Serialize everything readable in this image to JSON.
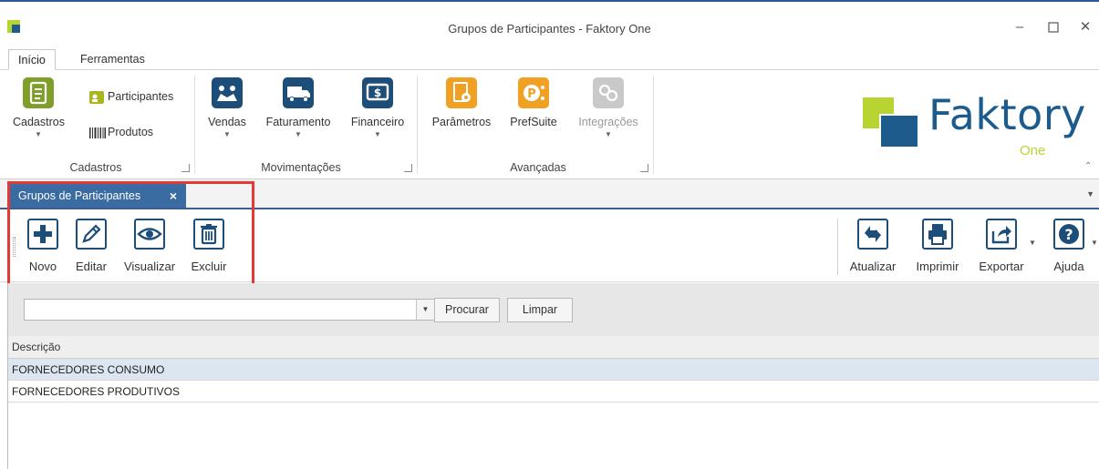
{
  "window": {
    "title": "Grupos de Participantes - Faktory One",
    "controls": [
      "minimize-icon",
      "maximize-icon",
      "close-icon"
    ]
  },
  "ribbon": {
    "tabs": [
      {
        "label": "Início",
        "active": true
      },
      {
        "label": "Ferramentas",
        "active": false
      }
    ],
    "groups": [
      {
        "label": "Cadastros",
        "large_buttons": [
          {
            "label": "Cadastros",
            "icon": "document-icon",
            "dropdown": true
          }
        ],
        "small_buttons": [
          {
            "label": "Participantes",
            "icon": "contact-card-icon"
          },
          {
            "label": "Produtos",
            "icon": "barcode-icon"
          }
        ]
      },
      {
        "label": "Movimentações",
        "large_buttons": [
          {
            "label": "Vendas",
            "icon": "handshake-icon",
            "dropdown": true
          },
          {
            "label": "Faturamento",
            "icon": "truck-icon",
            "dropdown": true
          },
          {
            "label": "Financeiro",
            "icon": "finance-icon",
            "dropdown": true
          }
        ]
      },
      {
        "label": "Avançadas",
        "large_buttons": [
          {
            "label": "Parâmetros",
            "icon": "settings-icon",
            "dropdown": false
          },
          {
            "label": "PrefSuite",
            "icon": "prefsuite-icon",
            "dropdown": false
          },
          {
            "label": "Integrações",
            "icon": "integration-icon",
            "dropdown": true,
            "disabled": true
          }
        ]
      }
    ],
    "logo": {
      "text": "Faktory",
      "subtext": "One"
    }
  },
  "document_tab": {
    "label": "Grupos de Participantes",
    "close": "×"
  },
  "toolbar": {
    "left": [
      {
        "label": "Novo",
        "icon": "plus-icon"
      },
      {
        "label": "Editar",
        "icon": "pencil-icon"
      },
      {
        "label": "Visualizar",
        "icon": "eye-icon"
      },
      {
        "label": "Excluir",
        "icon": "trash-icon"
      }
    ],
    "right": [
      {
        "label": "Atualizar",
        "icon": "refresh-icon"
      },
      {
        "label": "Imprimir",
        "icon": "printer-icon"
      },
      {
        "label": "Exportar",
        "icon": "export-icon"
      },
      {
        "label": "Ajuda",
        "icon": "help-icon"
      }
    ]
  },
  "search": {
    "value": "",
    "search_button": "Procurar",
    "clear_button": "Limpar"
  },
  "grid": {
    "columns": [
      "Descrição"
    ],
    "rows": [
      {
        "descricao": "FORNECEDORES CONSUMO",
        "selected": true
      },
      {
        "descricao": "FORNECEDORES PRODUTIVOS",
        "selected": false
      }
    ]
  },
  "colors": {
    "accent_blue": "#3a6ca2",
    "icon_blue": "#1d4e7a",
    "logo_green": "#b8d432",
    "highlight_red": "#e53935",
    "selected_row": "#dce6f1"
  }
}
